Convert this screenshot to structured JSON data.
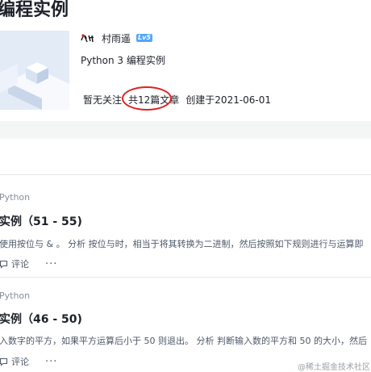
{
  "page": {
    "title": "编程实例"
  },
  "column": {
    "author_name": "村雨遥",
    "author_level": "Lv5",
    "description": "Python 3 编程实例",
    "follow_status": "暂无关注",
    "article_count": "共12篇文章",
    "created": "创建于2021-06-01"
  },
  "articles": [
    {
      "category": "Python",
      "title": "实例（51 - 55)",
      "abstract": "使用按位与 & 。 分析 按位与时，相当于将其转换为二进制，然后按照如下规则进行与运算即",
      "comment_label": "评论",
      "more_label": "···"
    },
    {
      "category": "Python",
      "title": "实例（46 - 50)",
      "abstract": "入数字的平方，如果平方运算后小于 50 则退出。 分析 判断输入数的平方和 50 的大小，然后",
      "comment_label": "评论",
      "more_label": "···"
    }
  ],
  "watermark": "@稀土掘金技术社区",
  "colors": {
    "annotation_circle": "#e02020",
    "level_badge": "#52a6ff",
    "muted_text": "#86909c"
  },
  "icons": {
    "comment": "comment-icon",
    "more": "more-icon"
  }
}
